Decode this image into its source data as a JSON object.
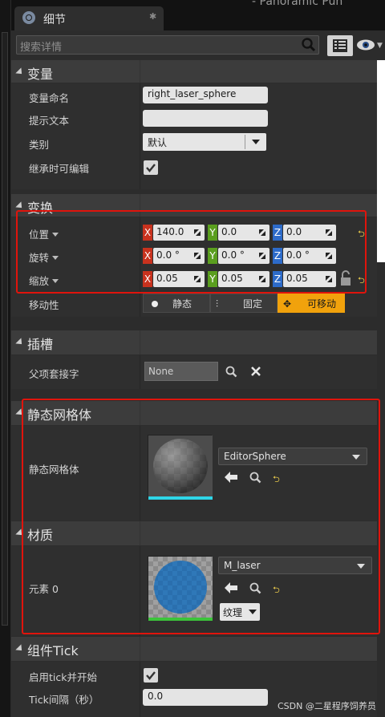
{
  "tab": {
    "title": "细节",
    "close": "✱"
  },
  "top_faint_text": "- Panoramic Pun",
  "search": {
    "placeholder": "搜索详情"
  },
  "sections": {
    "variable": "变量",
    "transform": "变换",
    "slot": "插槽",
    "static_mesh": "静态网格体",
    "material": "材质",
    "component_tick": "组件Tick"
  },
  "variable": {
    "name_label": "变量命名",
    "name_value": "right_laser_sphere",
    "tooltip_label": "提示文本",
    "tooltip_value": "",
    "category_label": "类别",
    "category_value": "默认",
    "editable_label": "继承时可编辑"
  },
  "transform": {
    "location_label": "位置",
    "rotation_label": "旋转",
    "scale_label": "缩放",
    "mobility_label": "移动性",
    "axis_x": "X",
    "axis_y": "Y",
    "axis_z": "Z",
    "location": {
      "x": "140.0",
      "y": "0.0",
      "z": "0.0"
    },
    "rotation": {
      "x": "0.0 °",
      "y": "0.0 °",
      "z": "0.0 °"
    },
    "scale": {
      "x": "0.05",
      "y": "0.05",
      "z": "0.05"
    },
    "mobility_options": [
      "静态",
      "固定",
      "可移动"
    ],
    "mobility_selected": "可移动"
  },
  "slot": {
    "parent_socket_label": "父项套接字",
    "parent_socket_value": "None"
  },
  "static_mesh": {
    "label": "静态网格体",
    "value": "EditorSphere"
  },
  "material": {
    "element_label": "元素 0",
    "value": "M_laser",
    "texture_button": "纹理"
  },
  "component_tick": {
    "start_label": "启用tick并开始",
    "interval_label": "Tick间隔（秒）",
    "interval_value": "0.0"
  },
  "watermark": "CSDN @二星程序饲养员",
  "colors": {
    "highlight_border": "#e0140c",
    "mobility_selected": "#f1a20c",
    "axis_x": "#c8321e",
    "axis_y": "#5a9e1e",
    "axis_z": "#2d6bc9"
  }
}
